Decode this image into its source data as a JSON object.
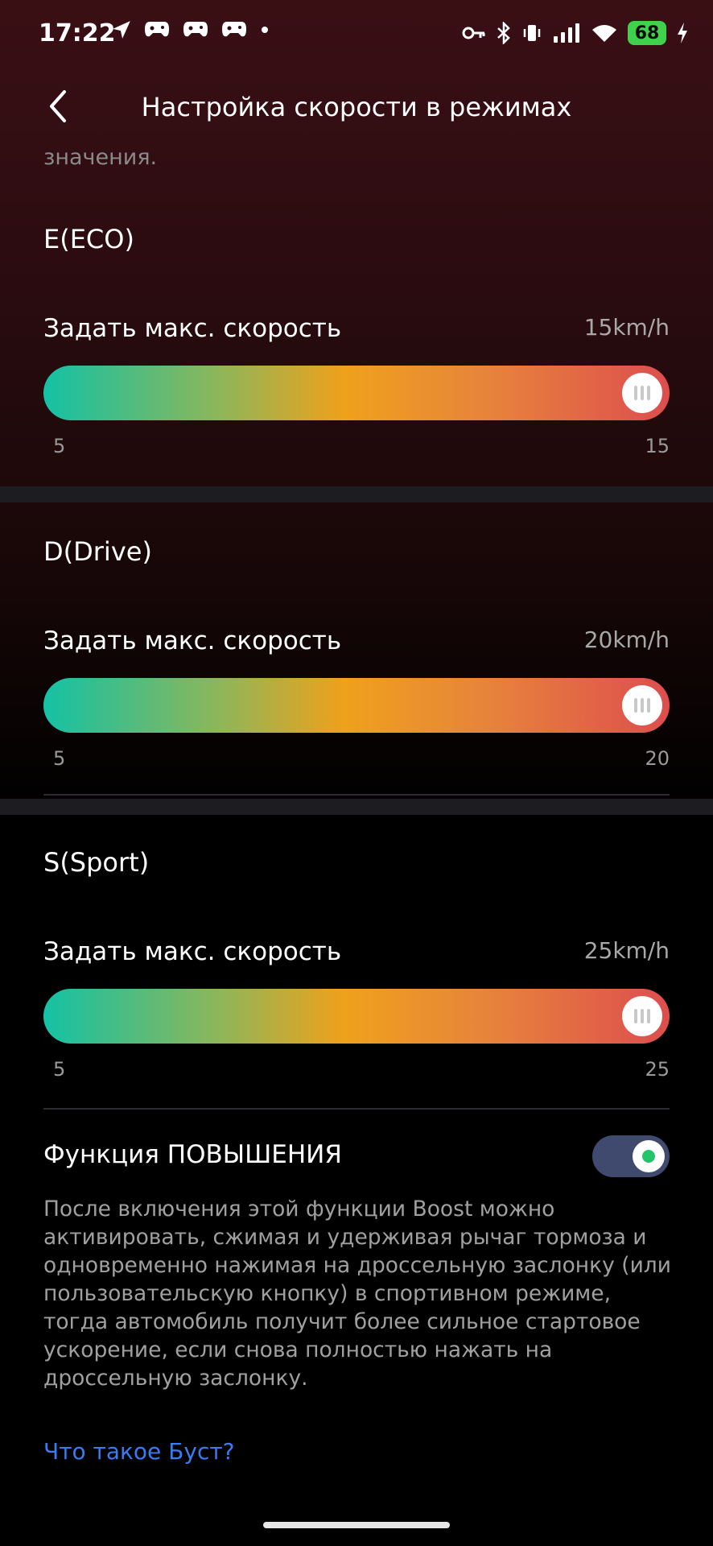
{
  "status_bar": {
    "time": "17:22",
    "left_icons": [
      "navigation-icon",
      "game-controller-icon",
      "game-controller-icon",
      "game-controller-icon",
      "dot-icon"
    ],
    "right_icons": [
      "key-icon",
      "bluetooth-icon",
      "vibrate-icon",
      "signal-icon",
      "wifi-icon"
    ],
    "battery": "68",
    "battery_color": "#3fd14b"
  },
  "header": {
    "title": "Настройка скорости в режимах",
    "back_icon": "chevron-left-icon"
  },
  "partial_text": "значения.",
  "modes": [
    {
      "title": "E(ECO)",
      "label": "Задать макс. скорость",
      "value": "15km/h",
      "min": "5",
      "max": "15",
      "level": 1.0
    },
    {
      "title": "D(Drive)",
      "label": "Задать макс. скорость",
      "value": "20km/h",
      "min": "5",
      "max": "20",
      "level": 1.0
    },
    {
      "title": "S(Sport)",
      "label": "Задать макс. скорость",
      "value": "25km/h",
      "min": "5",
      "max": "25",
      "level": 1.0
    }
  ],
  "boost": {
    "label": "Функция ПОВЫШЕНИЯ",
    "enabled": true,
    "description": "После включения этой функции Boost можно активировать, сжимая и удерживая рычаг тормоза и одновременно нажимая на дроссельную заслонку (или пользовательскую кнопку) в спортивном режиме, тогда автомобиль получит более сильное стартовое ускорение, если снова полностью нажать на дроссельную заслонку.",
    "link": "Что такое Буст?",
    "toggle_color": "#3f4a6e",
    "link_color": "#3a7cf0"
  },
  "colors": {
    "track_start": "#13c2a5",
    "track_mid": "#efa11c",
    "track_end": "#dd4e4f"
  }
}
